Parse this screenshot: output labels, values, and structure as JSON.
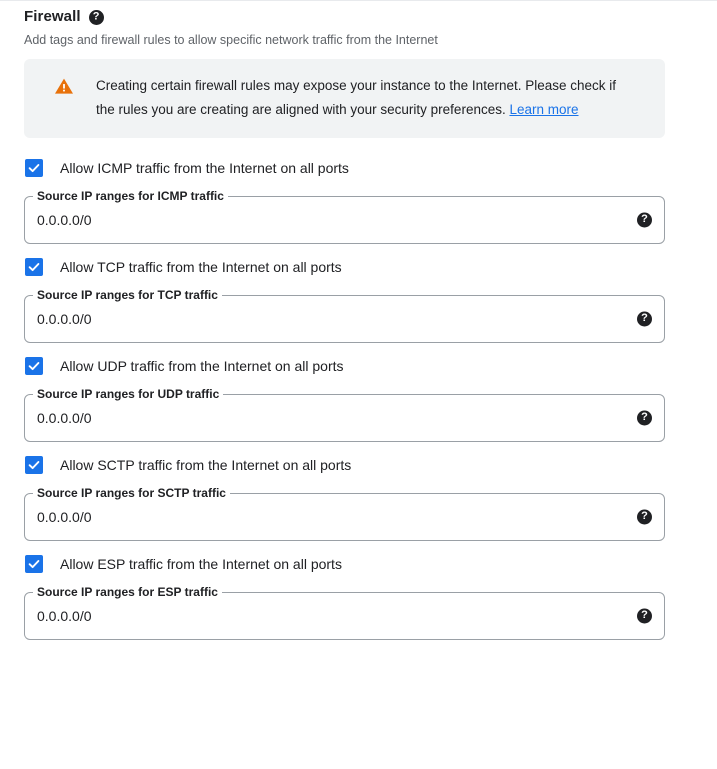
{
  "section": {
    "title": "Firewall",
    "help_icon": "help-circle-icon",
    "subtitle": "Add tags and firewall rules to allow specific network traffic from the Internet"
  },
  "warning": {
    "icon": "warning-triangle-icon",
    "icon_color": "#e8710a",
    "background": "#f1f3f4",
    "text": "Creating certain firewall rules may expose your instance to the Internet. Please check if the rules you are creating are aligned with your security preferences. ",
    "link_label": "Learn more",
    "link_color": "#1a73e8"
  },
  "colors": {
    "checkbox_checked": "#1a73e8",
    "field_border": "#9aa0a6",
    "text_primary": "#202124",
    "text_secondary": "#5f6368"
  },
  "rules": [
    {
      "checkbox_label": "Allow ICMP traffic from the Internet on all ports",
      "checked": true,
      "field_legend": "Source IP ranges for ICMP traffic",
      "field_value": "0.0.0.0/0",
      "field_placeholder": "0.0.0.0/0",
      "field_help_icon": "help-circle-icon"
    },
    {
      "checkbox_label": "Allow TCP traffic from the Internet on all ports",
      "checked": true,
      "field_legend": "Source IP ranges for TCP traffic",
      "field_value": "0.0.0.0/0",
      "field_placeholder": "0.0.0.0/0",
      "field_help_icon": "help-circle-icon"
    },
    {
      "checkbox_label": "Allow UDP traffic from the Internet on all ports",
      "checked": true,
      "field_legend": "Source IP ranges for UDP traffic",
      "field_value": "0.0.0.0/0",
      "field_placeholder": "0.0.0.0/0",
      "field_help_icon": "help-circle-icon"
    },
    {
      "checkbox_label": "Allow SCTP traffic from the Internet on all ports",
      "checked": true,
      "field_legend": "Source IP ranges for SCTP traffic",
      "field_value": "0.0.0.0/0",
      "field_placeholder": "0.0.0.0/0",
      "field_help_icon": "help-circle-icon"
    },
    {
      "checkbox_label": "Allow ESP traffic from the Internet on all ports",
      "checked": true,
      "field_legend": "Source IP ranges for ESP traffic",
      "field_value": "0.0.0.0/0",
      "field_placeholder": "0.0.0.0/0",
      "field_help_icon": "help-circle-icon"
    }
  ]
}
